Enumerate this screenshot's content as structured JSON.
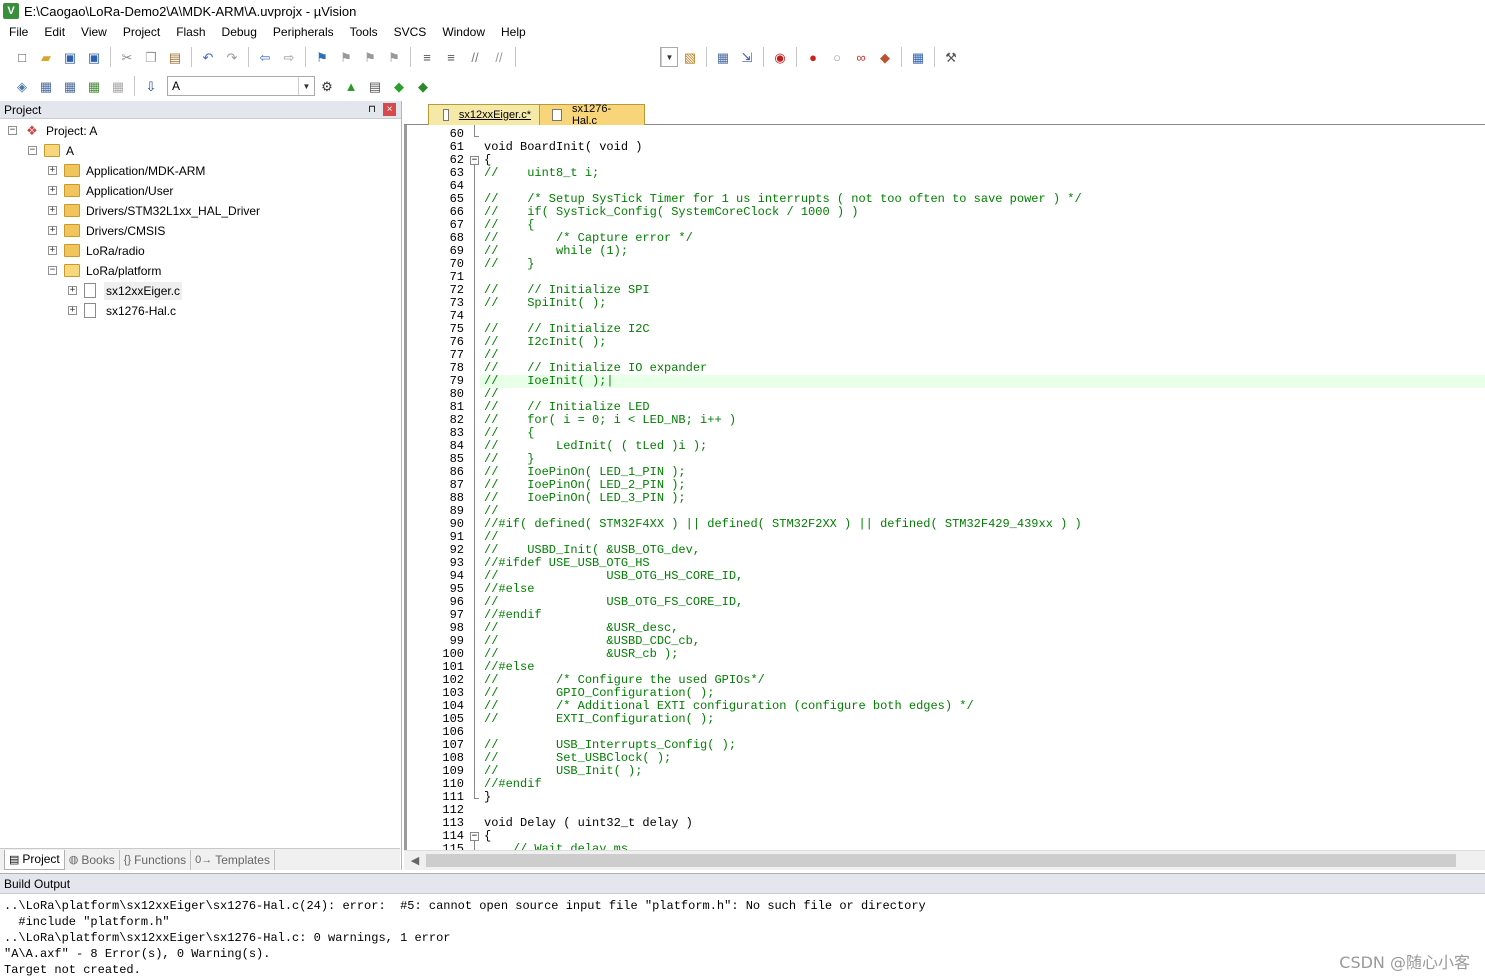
{
  "window": {
    "title": "E:\\Caogao\\LoRa-Demo2\\A\\MDK-ARM\\A.uvprojx - µVision",
    "icon_letter": "V"
  },
  "menu": [
    "File",
    "Edit",
    "View",
    "Project",
    "Flash",
    "Debug",
    "Peripherals",
    "Tools",
    "SVCS",
    "Window",
    "Help"
  ],
  "toolbar": {
    "target_name": "A",
    "icons_row1": [
      "new-file-icon",
      "open-file-icon",
      "save-icon",
      "save-all-icon",
      "cut-icon",
      "copy-icon",
      "paste-icon",
      "undo-icon",
      "redo-icon",
      "nav-back-icon",
      "nav-forward-icon",
      "bookmark-icon",
      "prev-bookmark-icon",
      "next-bookmark-icon",
      "clear-bookmarks-icon",
      "indent-icon",
      "unindent-icon",
      "comment-icon",
      "uncomment-icon",
      "find-in-files-icon",
      "find-icon",
      "incremental-find-icon",
      "debug-session-icon",
      "breakpoint-icon",
      "disable-breakpoint-icon",
      "disable-all-breakpoints-icon",
      "kill-all-breakpoints-icon",
      "window-layout-icon",
      "configure-icon"
    ],
    "icons_row2": [
      "translate-icon",
      "build-icon",
      "rebuild-icon",
      "batch-build-icon",
      "stop-build-icon",
      "download-icon",
      "target-options-icon",
      "manage-components-icon",
      "file-extensions-icon",
      "select-packs-icon",
      "pack-installer-icon"
    ]
  },
  "project_panel": {
    "title": "Project",
    "pin_glyph": "⊓",
    "close_glyph": "×",
    "tree": [
      {
        "label": "Project: A",
        "level": 0,
        "expander": "-",
        "icon": "project"
      },
      {
        "label": "A",
        "level": 1,
        "expander": "-",
        "icon": "folder-open"
      },
      {
        "label": "Application/MDK-ARM",
        "level": 2,
        "expander": "+",
        "icon": "folder"
      },
      {
        "label": "Application/User",
        "level": 2,
        "expander": "+",
        "icon": "folder"
      },
      {
        "label": "Drivers/STM32L1xx_HAL_Driver",
        "level": 2,
        "expander": "+",
        "icon": "folder"
      },
      {
        "label": "Drivers/CMSIS",
        "level": 2,
        "expander": "+",
        "icon": "folder"
      },
      {
        "label": "LoRa/radio",
        "level": 2,
        "expander": "+",
        "icon": "folder"
      },
      {
        "label": "LoRa/platform",
        "level": 2,
        "expander": "-",
        "icon": "folder-open"
      },
      {
        "label": "sx12xxEiger.c",
        "level": 3,
        "expander": "+",
        "icon": "file",
        "selected": true
      },
      {
        "label": "sx1276-Hal.c",
        "level": 3,
        "expander": "+",
        "icon": "file"
      }
    ],
    "tabs": [
      {
        "label": "Project",
        "icon": "▤",
        "active": true
      },
      {
        "label": "Books",
        "icon": "◍",
        "active": false
      },
      {
        "label": "Functions",
        "icon": "{}",
        "active": false
      },
      {
        "label": "Templates",
        "icon": "0→",
        "active": false
      }
    ]
  },
  "editor": {
    "tabs": [
      {
        "label": "sx12xxEiger.c*",
        "active": true
      },
      {
        "label": "sx1276-Hal.c",
        "active": false
      }
    ],
    "current_line": 79,
    "lines": [
      {
        "n": "60",
        "t": ""
      },
      {
        "n": "61",
        "t": "void BoardInit( void )"
      },
      {
        "n": "62",
        "t": "{",
        "fold": "-"
      },
      {
        "n": "63",
        "t": "//    uint8_t i;",
        "c": true
      },
      {
        "n": "64",
        "t": ""
      },
      {
        "n": "65",
        "t": "//    /* Setup SysTick Timer for 1 us interrupts ( not too often to save power ) */",
        "c": true
      },
      {
        "n": "66",
        "t": "//    if( SysTick_Config( SystemCoreClock / 1000 ) )",
        "c": true
      },
      {
        "n": "67",
        "t": "//    {",
        "c": true
      },
      {
        "n": "68",
        "t": "//        /* Capture error */",
        "c": true
      },
      {
        "n": "69",
        "t": "//        while (1);",
        "c": true
      },
      {
        "n": "70",
        "t": "//    }",
        "c": true
      },
      {
        "n": "71",
        "t": ""
      },
      {
        "n": "72",
        "t": "//    // Initialize SPI",
        "c": true
      },
      {
        "n": "73",
        "t": "//    SpiInit( );",
        "c": true
      },
      {
        "n": "74",
        "t": ""
      },
      {
        "n": "75",
        "t": "//    // Initialize I2C",
        "c": true
      },
      {
        "n": "76",
        "t": "//    I2cInit( );",
        "c": true
      },
      {
        "n": "77",
        "t": "//",
        "c": true
      },
      {
        "n": "78",
        "t": "//    // Initialize IO expander",
        "c": true
      },
      {
        "n": "79",
        "t": "//    IoeInit( );|",
        "c": true
      },
      {
        "n": "80",
        "t": "//",
        "c": true
      },
      {
        "n": "81",
        "t": "//    // Initialize LED",
        "c": true
      },
      {
        "n": "82",
        "t": "//    for( i = 0; i < LED_NB; i++ )",
        "c": true
      },
      {
        "n": "83",
        "t": "//    {",
        "c": true
      },
      {
        "n": "84",
        "t": "//        LedInit( ( tLed )i );",
        "c": true
      },
      {
        "n": "85",
        "t": "//    }",
        "c": true
      },
      {
        "n": "86",
        "t": "//    IoePinOn( LED_1_PIN );",
        "c": true
      },
      {
        "n": "87",
        "t": "//    IoePinOn( LED_2_PIN );",
        "c": true
      },
      {
        "n": "88",
        "t": "//    IoePinOn( LED_3_PIN );",
        "c": true
      },
      {
        "n": "89",
        "t": "//",
        "c": true
      },
      {
        "n": "90",
        "t": "//#if( defined( STM32F4XX ) || defined( STM32F2XX ) || defined( STM32F429_439xx ) )",
        "c": true
      },
      {
        "n": "91",
        "t": "//",
        "c": true
      },
      {
        "n": "92",
        "t": "//    USBD_Init( &USB_OTG_dev,",
        "c": true
      },
      {
        "n": "93",
        "t": "//#ifdef USE_USB_OTG_HS",
        "c": true
      },
      {
        "n": "94",
        "t": "//               USB_OTG_HS_CORE_ID,",
        "c": true
      },
      {
        "n": "95",
        "t": "//#else",
        "c": true
      },
      {
        "n": "96",
        "t": "//               USB_OTG_FS_CORE_ID,",
        "c": true
      },
      {
        "n": "97",
        "t": "//#endif",
        "c": true
      },
      {
        "n": "98",
        "t": "//               &USR_desc,",
        "c": true
      },
      {
        "n": "99",
        "t": "//               &USBD_CDC_cb,",
        "c": true
      },
      {
        "n": "100",
        "t": "//               &USR_cb );",
        "c": true
      },
      {
        "n": "101",
        "t": "//#else",
        "c": true
      },
      {
        "n": "102",
        "t": "//        /* Configure the used GPIOs*/",
        "c": true
      },
      {
        "n": "103",
        "t": "//        GPIO_Configuration( );",
        "c": true
      },
      {
        "n": "104",
        "t": "//        /* Additional EXTI configuration (configure both edges) */",
        "c": true
      },
      {
        "n": "105",
        "t": "//        EXTI_Configuration( );",
        "c": true
      },
      {
        "n": "106",
        "t": ""
      },
      {
        "n": "107",
        "t": "//        USB_Interrupts_Config( );",
        "c": true
      },
      {
        "n": "108",
        "t": "//        Set_USBClock( );",
        "c": true
      },
      {
        "n": "109",
        "t": "//        USB_Init( );",
        "c": true
      },
      {
        "n": "110",
        "t": "//#endif",
        "c": true
      },
      {
        "n": "111",
        "t": "}"
      },
      {
        "n": "112",
        "t": ""
      },
      {
        "n": "113",
        "t": "void Delay ( uint32_t delay )"
      },
      {
        "n": "114",
        "t": "{",
        "fold": "-"
      },
      {
        "n": "115",
        "t": "    // Wait delay ms",
        "c": true
      }
    ]
  },
  "build_output": {
    "title": "Build Output",
    "lines": [
      "..\\LoRa\\platform\\sx12xxEiger\\sx1276-Hal.c(24): error:  #5: cannot open source input file \"platform.h\": No such file or directory",
      "  #include \"platform.h\"",
      "..\\LoRa\\platform\\sx12xxEiger\\sx1276-Hal.c: 0 warnings, 1 error",
      "\"A\\A.axf\" - 8 Error(s), 0 Warning(s).",
      "Target not created."
    ]
  },
  "watermark": "CSDN @随心小客"
}
